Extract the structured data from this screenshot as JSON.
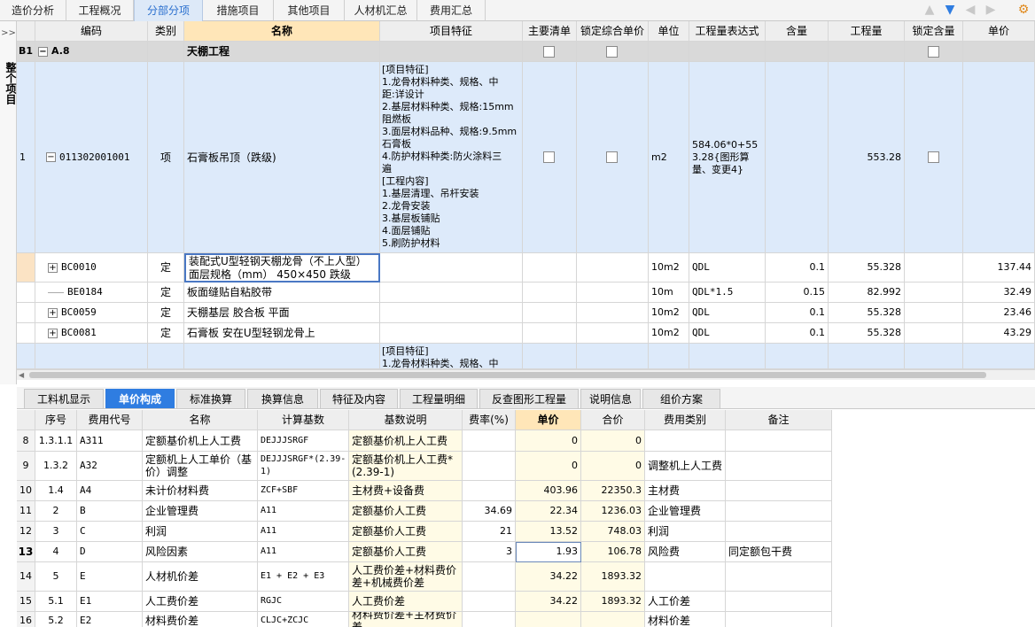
{
  "top_tabs": [
    "造价分析",
    "工程概况",
    "分部分项",
    "措施项目",
    "其他项目",
    "人材机汇总",
    "费用汇总"
  ],
  "active_top_tab": "分部分项",
  "left_panel": {
    "toggle": ">>",
    "label": "整个项目"
  },
  "grid": {
    "headers": [
      "编码",
      "类别",
      "名称",
      "项目特征",
      "主要清单",
      "锁定综合单价",
      "单位",
      "工程量表达式",
      "含量",
      "工程量",
      "锁定含量",
      "单价"
    ],
    "section": {
      "num": "B1",
      "code": "A.8",
      "name": "天棚工程"
    },
    "item": {
      "num": "1",
      "code": "011302001001",
      "type": "项",
      "name": "石膏板吊顶（跌级)",
      "feature_lines": [
        "[项目特征]",
        "1.龙骨材料种类、规格、中",
        "距:详设计",
        "2.基层材料种类、规格:15mm",
        "阻燃板",
        "3.面层材料品种、规格:9.5mm",
        "石膏板",
        "4.防护材料种类:防火涂料三",
        "遍",
        "[工程内容]",
        "1.基层清理、吊杆安装",
        "2.龙骨安装",
        "3.基层板铺贴",
        "4.面层铺贴",
        "5.刷防护材料"
      ],
      "unit": "m2",
      "expr": "584.06*0+553.28{图形算量、变更4}",
      "qty": "553.28"
    },
    "subs": [
      {
        "code": "BC0010",
        "type": "定",
        "name": "装配式U型轻钢天棚龙骨（不上人型） 面层规格（mm） 450×450 跌级",
        "unit": "10m2",
        "expr": "QDL",
        "content": "0.1",
        "qty": "55.328",
        "price": "137.44"
      },
      {
        "code": "BE0184",
        "type": "定",
        "name": "板面缝贴自粘胶带",
        "unit": "10m",
        "expr": "QDL*1.5",
        "content": "0.15",
        "qty": "82.992",
        "price": "32.49"
      },
      {
        "code": "BC0059",
        "type": "定",
        "name": "天棚基层 胶合板 平面",
        "unit": "10m2",
        "expr": "QDL",
        "content": "0.1",
        "qty": "55.328",
        "price": "23.46"
      },
      {
        "code": "BC0081",
        "type": "定",
        "name": "石膏板 安在U型轻钢龙骨上",
        "unit": "10m2",
        "expr": "QDL",
        "content": "0.1",
        "qty": "55.328",
        "price": "43.29"
      }
    ],
    "partial_features": [
      "[项目特征]",
      "1.龙骨材料种类、规格、中"
    ]
  },
  "bottom_tabs": [
    "工料机显示",
    "单价构成",
    "标准换算",
    "换算信息",
    "特征及内容",
    "工程量明细",
    "反查图形工程量",
    "说明信息",
    "组价方案"
  ],
  "active_bottom_tab": "单价构成",
  "detail": {
    "headers": [
      "序号",
      "费用代号",
      "名称",
      "计算基数",
      "基数说明",
      "费率(%)",
      "单价",
      "合价",
      "费用类别",
      "备注"
    ],
    "rows": [
      {
        "n": "8",
        "seq": "1.3.1.1",
        "code": "A311",
        "name": "定额基价机上人工费",
        "base": "DEJJJSRGF",
        "desc": "定额基价机上人工费",
        "rate": "",
        "price": "0",
        "total": "0",
        "cat": "",
        "note": ""
      },
      {
        "n": "9",
        "seq": "1.3.2",
        "code": "A32",
        "name": "定额机上人工单价（基价）调整",
        "base": "DEJJJSRGF*(2.39-1)",
        "desc": "定额基价机上人工费*(2.39-1)",
        "rate": "",
        "price": "0",
        "total": "0",
        "cat": "调整机上人工费",
        "note": ""
      },
      {
        "n": "10",
        "seq": "1.4",
        "code": "A4",
        "name": "未计价材料费",
        "base": "ZCF+SBF",
        "desc": "主材费+设备费",
        "rate": "",
        "price": "403.96",
        "total": "22350.3",
        "cat": "主材费",
        "note": ""
      },
      {
        "n": "11",
        "seq": "2",
        "code": "B",
        "name": "企业管理费",
        "base": "A11",
        "desc": "定额基价人工费",
        "rate": "34.69",
        "price": "22.34",
        "total": "1236.03",
        "cat": "企业管理费",
        "note": ""
      },
      {
        "n": "12",
        "seq": "3",
        "code": "C",
        "name": "利润",
        "base": "A11",
        "desc": "定额基价人工费",
        "rate": "21",
        "price": "13.52",
        "total": "748.03",
        "cat": "利润",
        "note": ""
      },
      {
        "n": "13",
        "seq": "4",
        "code": "D",
        "name": "风险因素",
        "base": "A11",
        "desc": "定额基价人工费",
        "rate": "3",
        "price": "1.93",
        "total": "106.78",
        "cat": "风险费",
        "note": "同定额包干费"
      },
      {
        "n": "14",
        "seq": "5",
        "code": "E",
        "name": "人材机价差",
        "base": "E1 + E2 + E3",
        "desc": "人工费价差+材料费价差+机械费价差",
        "rate": "",
        "price": "34.22",
        "total": "1893.32",
        "cat": "",
        "note": ""
      },
      {
        "n": "15",
        "seq": "5.1",
        "code": "E1",
        "name": "人工费价差",
        "base": "RGJC",
        "desc": "人工费价差",
        "rate": "",
        "price": "34.22",
        "total": "1893.32",
        "cat": "人工价差",
        "note": ""
      },
      {
        "n": "16",
        "seq": "5.2",
        "code": "E2",
        "name": "材料费价差",
        "base": "CLJC+ZCJC",
        "desc": "材料费价差+主材费价差",
        "rate": "",
        "price": "",
        "total": "",
        "cat": "材料价差",
        "note": ""
      }
    ]
  }
}
